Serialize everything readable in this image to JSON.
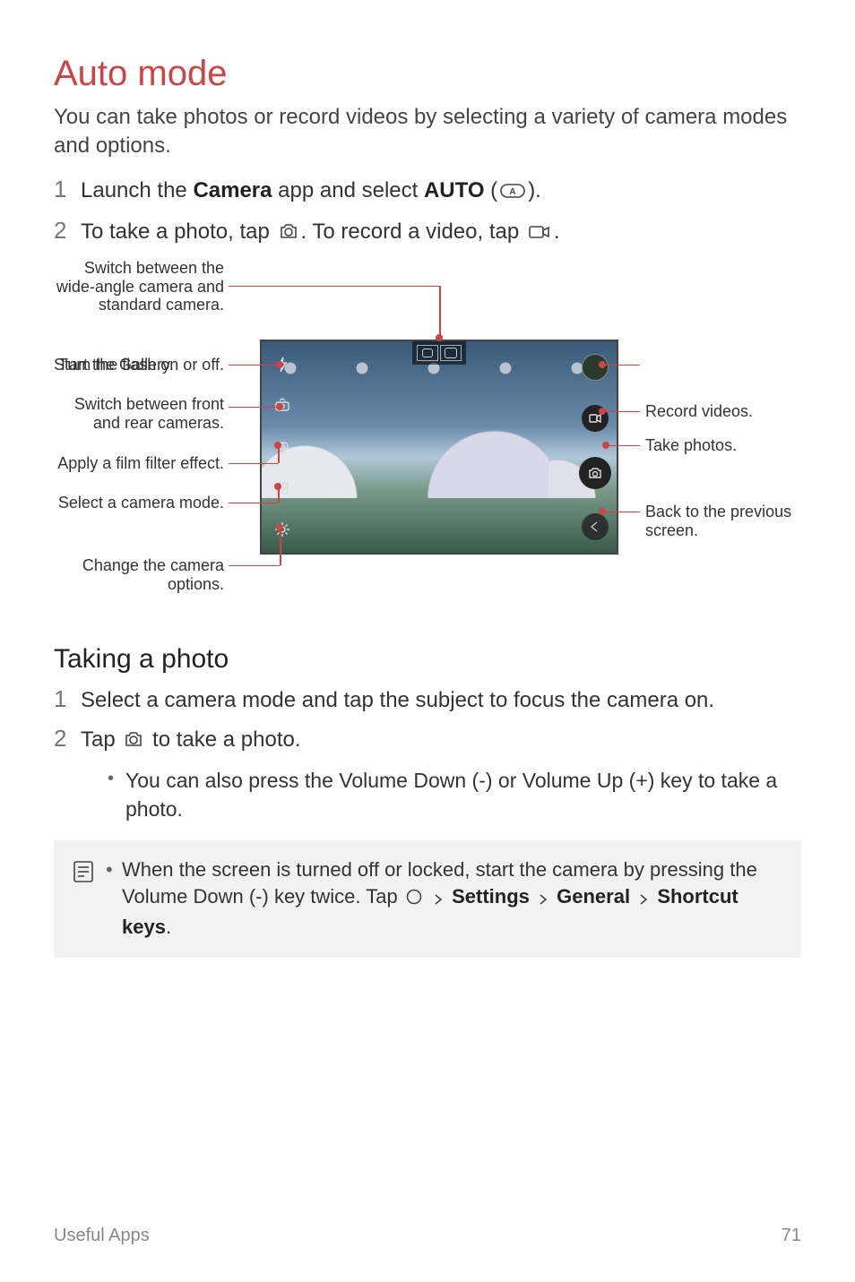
{
  "heading": "Auto mode",
  "intro": "You can take photos or record videos by selecting a variety of camera modes and options.",
  "steps1": {
    "n1": "1",
    "s1a": "Launch the ",
    "s1b": "Camera",
    "s1c": " app and select ",
    "s1d": "AUTO",
    "s1e": " (",
    "s1f": ").",
    "n2": "2",
    "s2a": "To take a photo, tap ",
    "s2b": ". To record a video, tap ",
    "s2c": "."
  },
  "diagram": {
    "left1": "Switch between the wide-angle camera and standard camera.",
    "left2": "Turn the flash on or off.",
    "left3": "Switch between front and rear cameras.",
    "left4": "Apply a film filter effect.",
    "left5": "Select a camera mode.",
    "left6": "Change the camera options.",
    "right1": "Start the Gallery.",
    "right2": "Record videos.",
    "right3": "Take photos.",
    "right4": "Back to the previous screen."
  },
  "subheading": "Taking a photo",
  "steps2": {
    "n1": "1",
    "s1": "Select a camera mode and tap the subject to focus the camera on.",
    "n2": "2",
    "s2a": "Tap ",
    "s2b": " to take a photo.",
    "b1": "You can also press the Volume Down (-) or Volume Up (+) key to take a photo."
  },
  "note": {
    "a": "When the screen is turned off or locked, start the camera by pressing the Volume Down (-) key twice. Tap ",
    "b": "Settings",
    "c": "General",
    "d": "Shortcut keys",
    "e": "."
  },
  "footer": {
    "section": "Useful Apps",
    "page": "71"
  }
}
